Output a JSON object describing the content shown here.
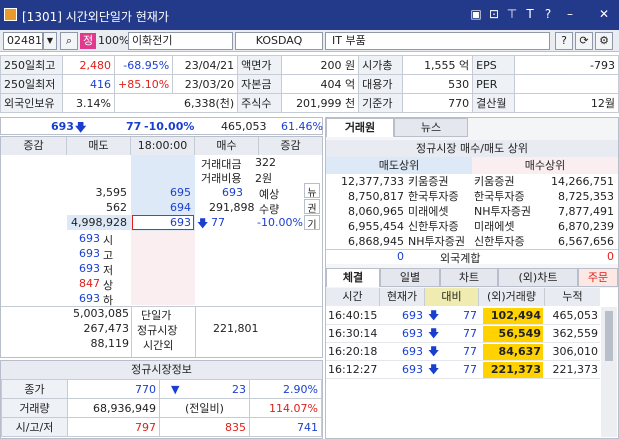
{
  "titlebar": {
    "title": "[1301] 시간외단일가 현재가",
    "icons": [
      "window-icon",
      "lock-icon",
      "pin-icon",
      "text-icon",
      "help-icon",
      "minimize-icon",
      "close-icon"
    ]
  },
  "toolbar": {
    "code": "024810",
    "badge": "정",
    "percent": "100%",
    "name": "이화전기",
    "market": "KOSDAQ",
    "sector": "IT 부품"
  },
  "info": {
    "rows": [
      [
        "250일최고",
        "2,480",
        "-68.95%",
        "23/04/21",
        "액면가",
        "200 원",
        "시가총",
        "1,555 억",
        "EPS",
        "-793"
      ],
      [
        "250일최저",
        "416",
        "+85.10%",
        "23/03/20",
        "자본금",
        "404 억",
        "대용가",
        "530",
        "PER",
        ""
      ],
      [
        "외국인보유",
        "3.14%",
        "6,338(천)",
        "",
        "주식수",
        "201,999 천",
        "기준가",
        "770",
        "결산월",
        "12월"
      ]
    ]
  },
  "summary": {
    "price": "693",
    "change": "77",
    "pct": "-10.00%",
    "volume": "465,053",
    "ratio": "61.46%"
  },
  "orderbook": {
    "headers": [
      "증감",
      "매도",
      "18:00:00",
      "매수",
      "증감"
    ],
    "info_labels": [
      "거래대금",
      "거래비용"
    ],
    "info_values": [
      "322",
      "2원"
    ],
    "asks": [
      {
        "qty": "3,595",
        "price": "695"
      },
      {
        "qty": "562",
        "price": "694"
      },
      {
        "qty": "4,998,928",
        "price": "693"
      }
    ],
    "expected": {
      "price": "693",
      "label1": "예상",
      "volume": "291,898",
      "label2": "수량",
      "change": "77",
      "pct": "-10.00%"
    },
    "side_labels": [
      "뉴",
      "권",
      "기"
    ],
    "stats": [
      {
        "v": "693",
        "k": "시"
      },
      {
        "v": "693",
        "k": "고"
      },
      {
        "v": "693",
        "k": "저"
      },
      {
        "v": "847",
        "k": "상"
      },
      {
        "v": "693",
        "k": "하"
      }
    ],
    "footer": [
      {
        "sell": "5,003,085",
        "label": "단일가",
        "buy": ""
      },
      {
        "sell": "267,473",
        "label": "정규시장",
        "buy": "221,801"
      },
      {
        "sell": "88,119",
        "label": "시간외",
        "buy": ""
      }
    ]
  },
  "regular": {
    "title": "정규시장정보",
    "rows": [
      {
        "label": "종가",
        "a": "770",
        "b": "23",
        "c": "2.90%"
      },
      {
        "label": "거래량",
        "a": "68,936,949",
        "b": "(전일비)",
        "c": "114.07%"
      },
      {
        "label": "시/고/저",
        "a": "797",
        "b": "835",
        "c": "741"
      }
    ]
  },
  "right": {
    "tabs": [
      "거래원",
      "뉴스"
    ],
    "broker_title": "정규시장 매수/매도 상위",
    "broker_headers": [
      "매도상위",
      "매수상위"
    ],
    "brokers": [
      {
        "sq": "12,377,733",
        "sn": "키움증권",
        "bn": "키움증권",
        "bq": "14,266,751"
      },
      {
        "sq": "8,750,817",
        "sn": "한국투자증",
        "bn": "한국투자증",
        "bq": "8,725,353"
      },
      {
        "sq": "8,060,965",
        "sn": "미래에셋",
        "bn": "NH투자증권",
        "bq": "7,877,491"
      },
      {
        "sq": "6,955,454",
        "sn": "신한투자증",
        "bn": "미래에셋",
        "bq": "6,870,239"
      },
      {
        "sq": "6,868,945",
        "sn": "NH투자증권",
        "bn": "신한투자증",
        "bq": "6,567,656"
      }
    ],
    "foreign": {
      "sell": "0",
      "label": "외국계합",
      "buy": "0"
    },
    "trade_tabs": [
      "체결",
      "일별",
      "차트",
      "(외)차트",
      "주문"
    ],
    "trade_headers": [
      "시간",
      "현재가",
      "대비",
      "(외)거래량",
      "누적"
    ],
    "trades": [
      {
        "time": "16:40:15",
        "price": "693",
        "diff": "77",
        "vol": "102,494",
        "cum": "465,053"
      },
      {
        "time": "16:30:14",
        "price": "693",
        "diff": "77",
        "vol": "56,549",
        "cum": "362,559"
      },
      {
        "time": "16:20:18",
        "price": "693",
        "diff": "77",
        "vol": "84,637",
        "cum": "306,010"
      },
      {
        "time": "16:12:27",
        "price": "693",
        "diff": "77",
        "vol": "221,373",
        "cum": "221,373"
      }
    ]
  }
}
